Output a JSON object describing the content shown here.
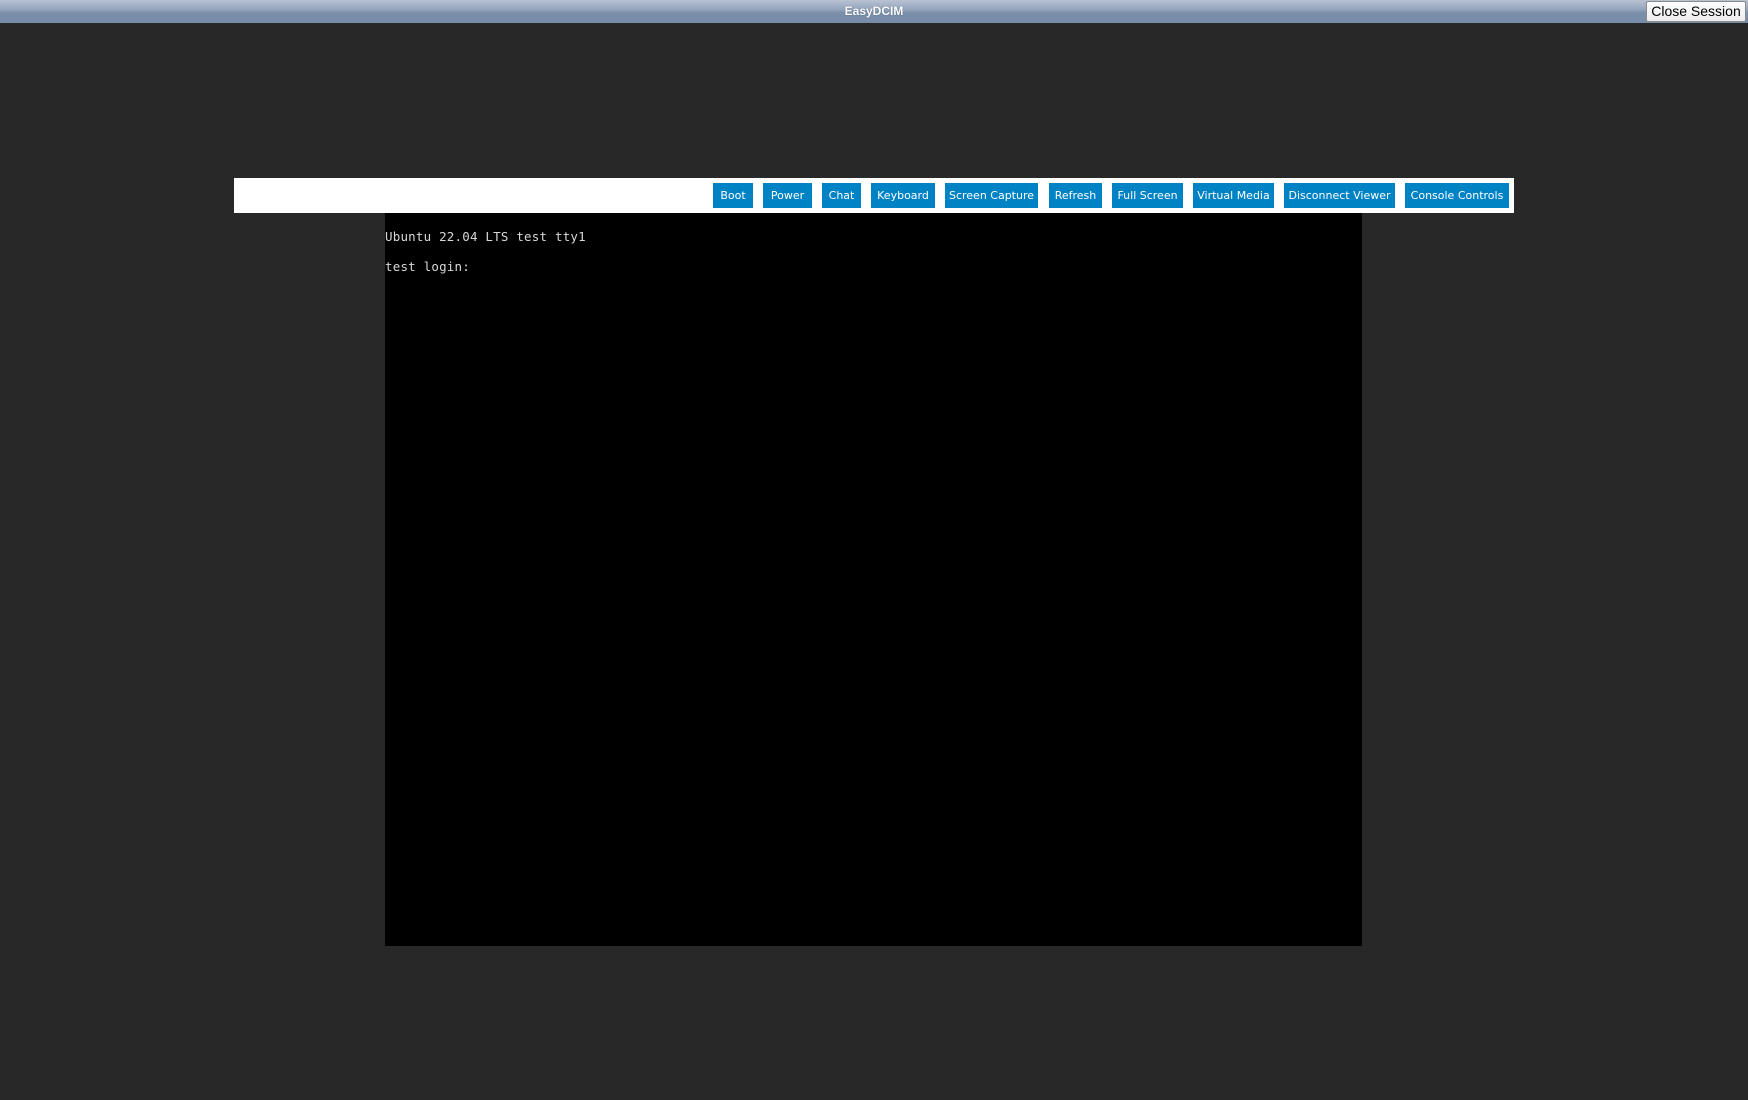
{
  "window": {
    "title": "EasyDCIM",
    "close_session_label": "Close Session"
  },
  "toolbar": {
    "buttons": [
      {
        "label": "Boot"
      },
      {
        "label": "Power"
      },
      {
        "label": "Chat"
      },
      {
        "label": "Keyboard"
      },
      {
        "label": "Screen Capture"
      },
      {
        "label": "Refresh"
      },
      {
        "label": "Full Screen"
      },
      {
        "label": "Virtual Media"
      },
      {
        "label": "Disconnect Viewer"
      },
      {
        "label": "Console Controls"
      }
    ]
  },
  "console": {
    "lines": [
      "Ubuntu 22.04 LTS test tty1",
      "test login:"
    ]
  },
  "colors": {
    "button_bg": "#0083c5",
    "button_text": "#ffffff",
    "page_bg": "#282828",
    "console_bg": "#000000"
  }
}
